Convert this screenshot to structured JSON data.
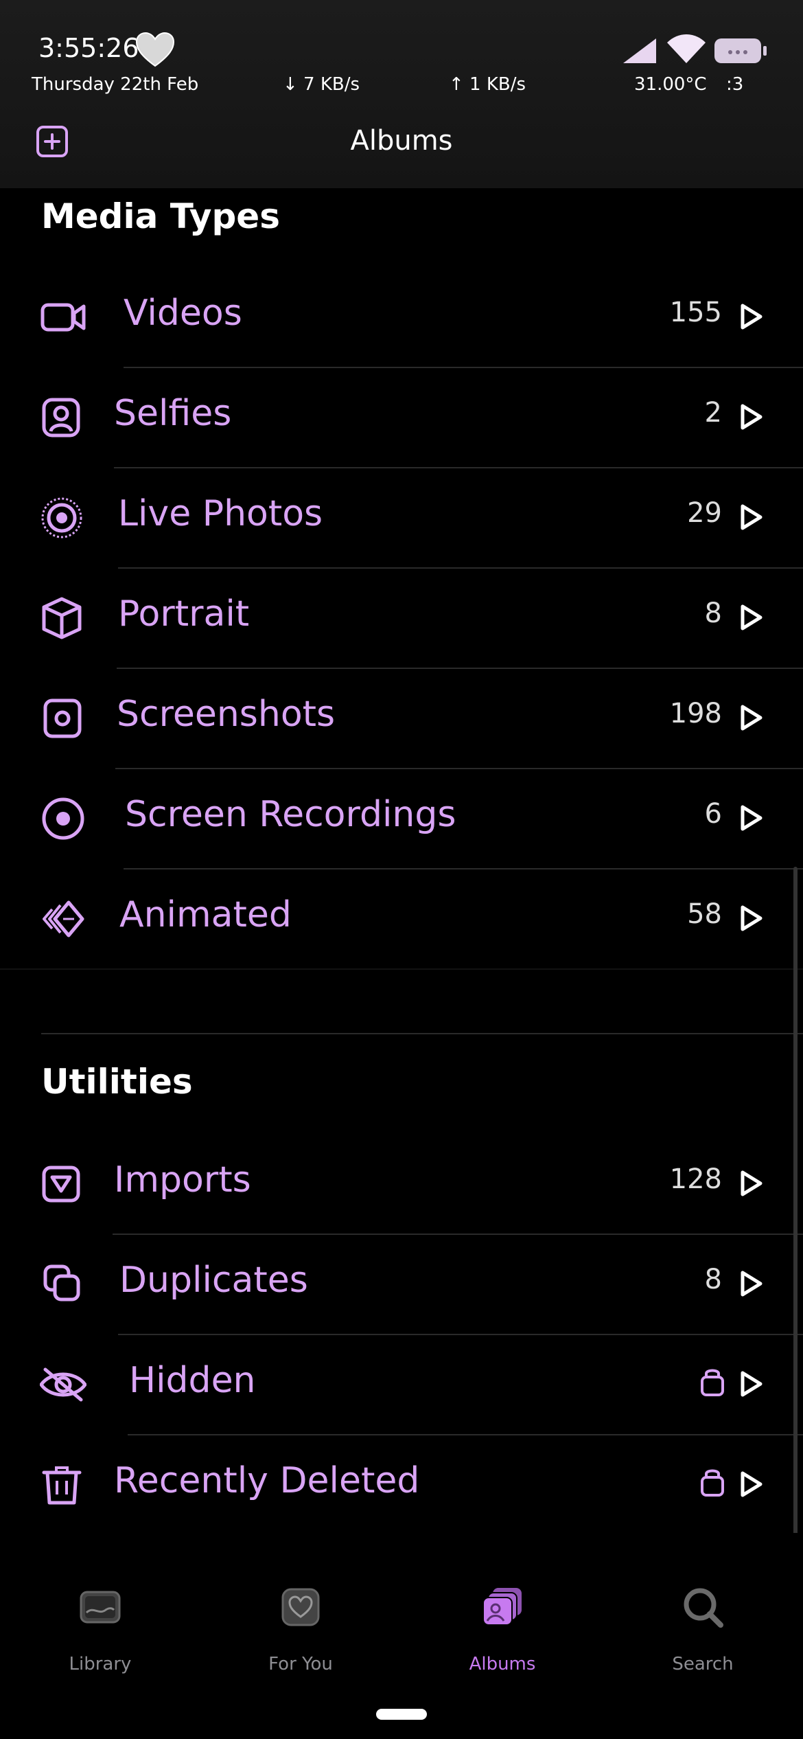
{
  "status": {
    "time": "3:55:26",
    "date": "Thursday 22th Feb",
    "down": "↓ 7 KB/s",
    "up": "↑ 1 KB/s",
    "temp": "31.00°C",
    "battery_text": ":3"
  },
  "nav": {
    "title": "Albums"
  },
  "media_types": {
    "title": "Media Types",
    "items": [
      {
        "label": "Videos",
        "count": "155",
        "icon": "video-camera-icon"
      },
      {
        "label": "Selfies",
        "count": "2",
        "icon": "selfie-icon"
      },
      {
        "label": "Live Photos",
        "count": "29",
        "icon": "live-photo-icon"
      },
      {
        "label": "Portrait",
        "count": "8",
        "icon": "portrait-cube-icon"
      },
      {
        "label": "Screenshots",
        "count": "198",
        "icon": "screenshot-icon"
      },
      {
        "label": "Screen Recordings",
        "count": "6",
        "icon": "screen-recording-icon"
      },
      {
        "label": "Animated",
        "count": "58",
        "icon": "animated-icon"
      }
    ]
  },
  "utilities": {
    "title": "Utilities",
    "items": [
      {
        "label": "Imports",
        "count": "128",
        "icon": "import-icon"
      },
      {
        "label": "Duplicates",
        "count": "8",
        "icon": "duplicates-icon"
      },
      {
        "label": "Hidden",
        "count": "",
        "icon": "eye-slash-icon",
        "locked": true
      },
      {
        "label": "Recently Deleted",
        "count": "",
        "icon": "trash-icon",
        "locked": true
      }
    ]
  },
  "tabs": [
    {
      "label": "Library",
      "icon": "photo-library-icon"
    },
    {
      "label": "For You",
      "icon": "heart-icon"
    },
    {
      "label": "Albums",
      "icon": "albums-icon",
      "active": true
    },
    {
      "label": "Search",
      "icon": "search-icon"
    }
  ],
  "colors": {
    "accent": "#d9a4f5",
    "tab_active": "#c77af0",
    "background": "#000000"
  }
}
